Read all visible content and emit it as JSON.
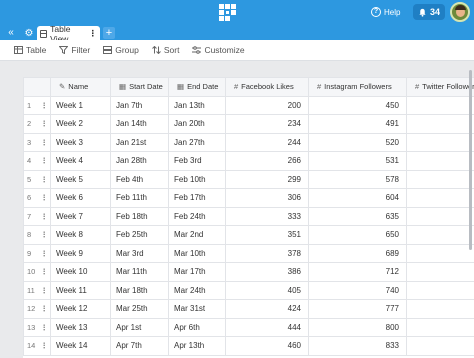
{
  "header": {
    "help_label": "Help",
    "notifications_count": "34",
    "accent_color": "#2d98e0"
  },
  "tabs": {
    "active_label": "Table View",
    "add_label": "+"
  },
  "toolbar": {
    "table_label": "Table",
    "filter_label": "Filter",
    "group_label": "Group",
    "sort_label": "Sort",
    "customize_label": "Customize"
  },
  "table": {
    "columns": [
      "Name",
      "Start Date",
      "End Date",
      "Facebook Likes",
      "Instagram Followers",
      "Twitter Follower"
    ],
    "rows": [
      {
        "n": "1",
        "name": "Week 1",
        "start": "Jan 7th",
        "end": "Jan 13th",
        "fb": "200",
        "ig": "450"
      },
      {
        "n": "2",
        "name": "Week 2",
        "start": "Jan 14th",
        "end": "Jan 20th",
        "fb": "234",
        "ig": "491"
      },
      {
        "n": "3",
        "name": "Week 3",
        "start": "Jan 21st",
        "end": "Jan 27th",
        "fb": "244",
        "ig": "520"
      },
      {
        "n": "4",
        "name": "Week 4",
        "start": "Jan 28th",
        "end": "Feb 3rd",
        "fb": "266",
        "ig": "531"
      },
      {
        "n": "5",
        "name": "Week 5",
        "start": "Feb 4th",
        "end": "Feb 10th",
        "fb": "299",
        "ig": "578"
      },
      {
        "n": "6",
        "name": "Week 6",
        "start": "Feb 11th",
        "end": "Feb 17th",
        "fb": "306",
        "ig": "604"
      },
      {
        "n": "7",
        "name": "Week 7",
        "start": "Feb 18th",
        "end": "Feb 24th",
        "fb": "333",
        "ig": "635"
      },
      {
        "n": "8",
        "name": "Week 8",
        "start": "Feb 25th",
        "end": "Mar 2nd",
        "fb": "351",
        "ig": "650"
      },
      {
        "n": "9",
        "name": "Week 9",
        "start": "Mar 3rd",
        "end": "Mar 10th",
        "fb": "378",
        "ig": "689"
      },
      {
        "n": "10",
        "name": "Week 10",
        "start": "Mar 11th",
        "end": "Mar 17th",
        "fb": "386",
        "ig": "712"
      },
      {
        "n": "11",
        "name": "Week 11",
        "start": "Mar 18th",
        "end": "Mar 24th",
        "fb": "405",
        "ig": "740"
      },
      {
        "n": "12",
        "name": "Week 12",
        "start": "Mar 25th",
        "end": "Mar 31st",
        "fb": "424",
        "ig": "777"
      },
      {
        "n": "13",
        "name": "Week 13",
        "start": "Apr 1st",
        "end": "Apr 6th",
        "fb": "444",
        "ig": "800"
      },
      {
        "n": "14",
        "name": "Week 14",
        "start": "Apr 7th",
        "end": "Apr 13th",
        "fb": "460",
        "ig": "833"
      }
    ]
  }
}
